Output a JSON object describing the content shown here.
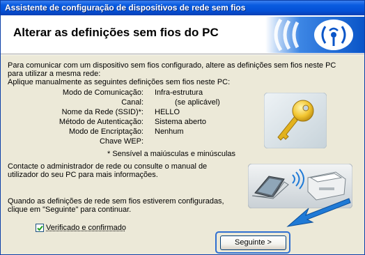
{
  "window": {
    "title": "Assistente de configuração de dispositivos de rede sem fios"
  },
  "header": {
    "title": "Alterar as definições sem fios do PC",
    "icon": "wireless-signal-icon"
  },
  "intro": {
    "line1": "Para comunicar com um dispositivo sem fios configurado, altere as definições sem fios neste PC",
    "line2": "para utilizar a mesma rede:",
    "line3": "Aplique manualmente as seguintes definições sem fios neste PC:"
  },
  "settings": [
    {
      "label": "Modo de Comunicação:",
      "value": "Infra-estrutura"
    },
    {
      "label": "Canal:",
      "value": "(se aplicável)"
    },
    {
      "label": "Nome da Rede (SSID)*:",
      "value": "HELLO"
    },
    {
      "label": "Método de Autenticação:",
      "value": "Sistema aberto"
    },
    {
      "label": "Modo de Encriptação:",
      "value": "Nenhum"
    },
    {
      "label": "Chave WEP:",
      "value": ""
    }
  ],
  "footnote": "* Sensível a maiúsculas e minúsculas",
  "contact": {
    "line1": "Contacte o administrador de rede ou consulte o manual de",
    "line2": "utilizador do seu PC para mais informações."
  },
  "instruction": {
    "line1": "Quando as definições de rede sem fios estiverem configuradas,",
    "line2": "clique em \"Seguinte\" para continuar."
  },
  "checkbox": {
    "label": "Verificado e confirmado",
    "checked": true
  },
  "next_button": {
    "label": "Seguinte >"
  },
  "illustrations": {
    "key": "key-icon",
    "devices": "laptop-printer-wireless-icon",
    "arrow": "pointer-arrow-icon"
  },
  "colors": {
    "titlebar": "#0450d6",
    "dialog_bg": "#ece9d8",
    "arrow_blue": "#1f7ad6",
    "focus_ring": "#2f6fd1"
  }
}
